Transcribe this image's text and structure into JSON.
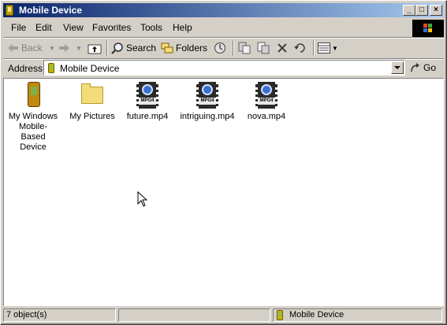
{
  "window": {
    "title": "Mobile Device",
    "controls": [
      "minimize",
      "maximize",
      "close"
    ]
  },
  "menu": [
    "File",
    "Edit",
    "View",
    "Favorites",
    "Tools",
    "Help"
  ],
  "toolbar": {
    "back_label": "Back",
    "search_label": "Search",
    "folders_label": "Folders",
    "icons": [
      "back-icon",
      "forward-icon",
      "up-folder-icon",
      "search-icon",
      "folders-icon",
      "history-icon",
      "move-to-icon",
      "copy-to-icon",
      "delete-icon",
      "undo-icon",
      "views-icon"
    ]
  },
  "address": {
    "label": "Address",
    "value": "Mobile Device",
    "go_label": "Go"
  },
  "items": [
    {
      "name": "My Windows Mobile-Based Device",
      "icon": "mobile-device-icon"
    },
    {
      "name": "My Pictures",
      "icon": "folder-icon"
    },
    {
      "name": "future.mp4",
      "icon": "mp4-file-icon",
      "tag": "MPG4"
    },
    {
      "name": "intriguing.mp4",
      "icon": "mp4-file-icon",
      "tag": "MPG4"
    },
    {
      "name": "nova.mp4",
      "icon": "mp4-file-icon",
      "tag": "MPG4"
    }
  ],
  "status": {
    "objects": "7 object(s)",
    "zone": "Mobile Device"
  },
  "colors": {
    "titlebar_start": "#0a246a",
    "titlebar_end": "#a6caf0",
    "face": "#d4d0c8"
  }
}
